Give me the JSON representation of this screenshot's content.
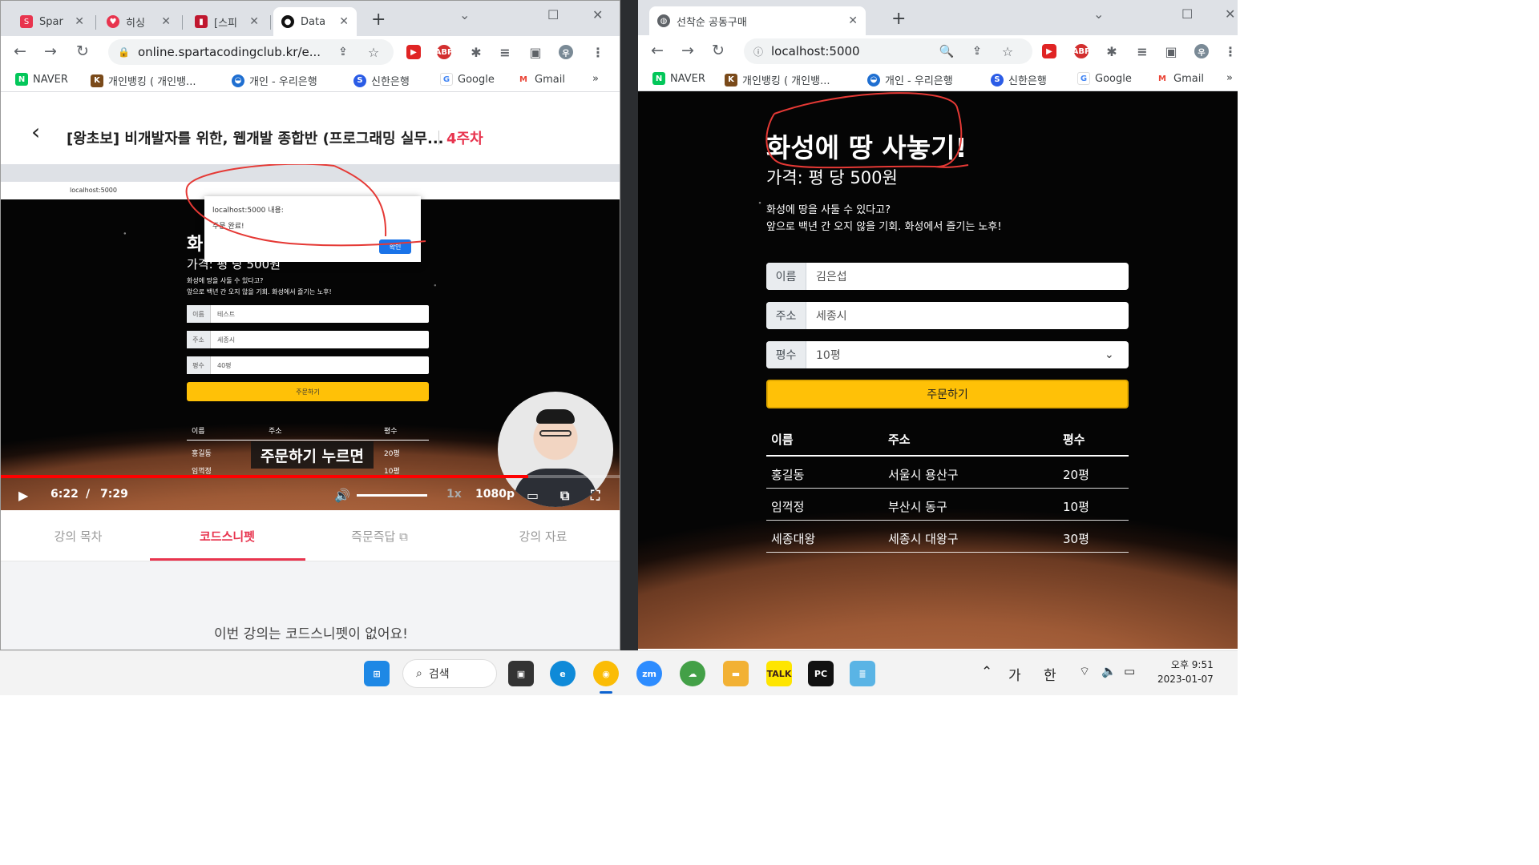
{
  "left_browser": {
    "tabs": [
      {
        "label": "Spar",
        "icon": "sparta-icon",
        "color": "#e8344e"
      },
      {
        "label": "히싱",
        "icon": "heart-icon",
        "color": "#e8344e"
      },
      {
        "label": "[스피",
        "icon": "note-icon",
        "color": "#c0172f"
      },
      {
        "label": "Data",
        "icon": "leaf-icon",
        "color": "#111111"
      }
    ],
    "address": "online.spartacodingclub.kr/e...",
    "lecture_title": "[왕초보] 비개발자를 위한, 웹개발 종합반 (프로그래밍 실무...",
    "lecture_week": "4주차",
    "video": {
      "inner_address": "localhost:5000",
      "dialog_title": "localhost:5000 내용:",
      "dialog_body": "주문 완료!",
      "dialog_button": "확인",
      "mini_heading": "화",
      "mini_price": "가격: 평 당 500원",
      "mini_desc": [
        "화성에 땅을 사둘 수 있다고?",
        "앞으로 백년 간 오지 않을 기회. 화성에서 즐기는 노후!"
      ],
      "mini_fields": [
        {
          "label": "이름",
          "value": "테스트"
        },
        {
          "label": "주소",
          "value": "세종시"
        },
        {
          "label": "평수",
          "value": "40평"
        }
      ],
      "mini_button": "주문하기",
      "mini_table_head": [
        "이름",
        "주소",
        "평수"
      ],
      "mini_table_row": [
        "홍길동",
        "",
        "20평"
      ],
      "mini_table_row2": [
        "임꺽정",
        "",
        "10평"
      ],
      "caption": "주문하기 누르면",
      "time_current": "6:22",
      "time_sep": "/",
      "time_total": "7:29",
      "speed": "1x",
      "quality": "1080p",
      "progress": 0.85
    },
    "tabs_below": [
      "강의 목차",
      "코드스니펫",
      "즉문즉답",
      "강의 자료"
    ],
    "active_tab": "코드스니펫",
    "snippet_message": "이번 강의는 코드스니펫이 없어요!"
  },
  "right_browser": {
    "tab_title": "선착순 공동구매",
    "address": "localhost:5000",
    "page": {
      "title": "화성에 땅 사놓기!",
      "price": "가격: 평 당 500원",
      "desc1": "화성에 땅을 사둘 수 있다고?",
      "desc2": "앞으로 백년 간 오지 않을 기회. 화성에서 즐기는 노후!",
      "name_label": "이름",
      "name_value": "김은섭",
      "address_label": "주소",
      "address_value": "세종시",
      "size_label": "평수",
      "size_value": "10평",
      "order_button": "주문하기",
      "table_head": [
        "이름",
        "주소",
        "평수"
      ],
      "table_rows": [
        [
          "홍길동",
          "서울시 용산구",
          "20평"
        ],
        [
          "임꺽정",
          "부산시 동구",
          "10평"
        ],
        [
          "세종대왕",
          "세종시 대왕구",
          "30평"
        ]
      ]
    }
  },
  "bookmarks": [
    {
      "label": "NAVER",
      "icon": "naver-icon",
      "color": "#03c75a"
    },
    {
      "label": "개인뱅킹 ( 개인뱅...",
      "icon": "bank-icon",
      "color": "#7a4a1a"
    },
    {
      "label": "개인 - 우리은행",
      "icon": "woori-icon",
      "color": "#1f6fd1"
    },
    {
      "label": "신한은행",
      "icon": "shinhan-icon",
      "color": "#2b5ce6"
    },
    {
      "label": "Google",
      "icon": "google-icon",
      "color": "#4285f4"
    },
    {
      "label": "Gmail",
      "icon": "gmail-icon",
      "color": "#ea4335"
    }
  ],
  "taskbar": {
    "search_label": "검색",
    "ime1": "가",
    "ime2": "한",
    "time": "오후 9:51",
    "date": "2023-01-07"
  }
}
